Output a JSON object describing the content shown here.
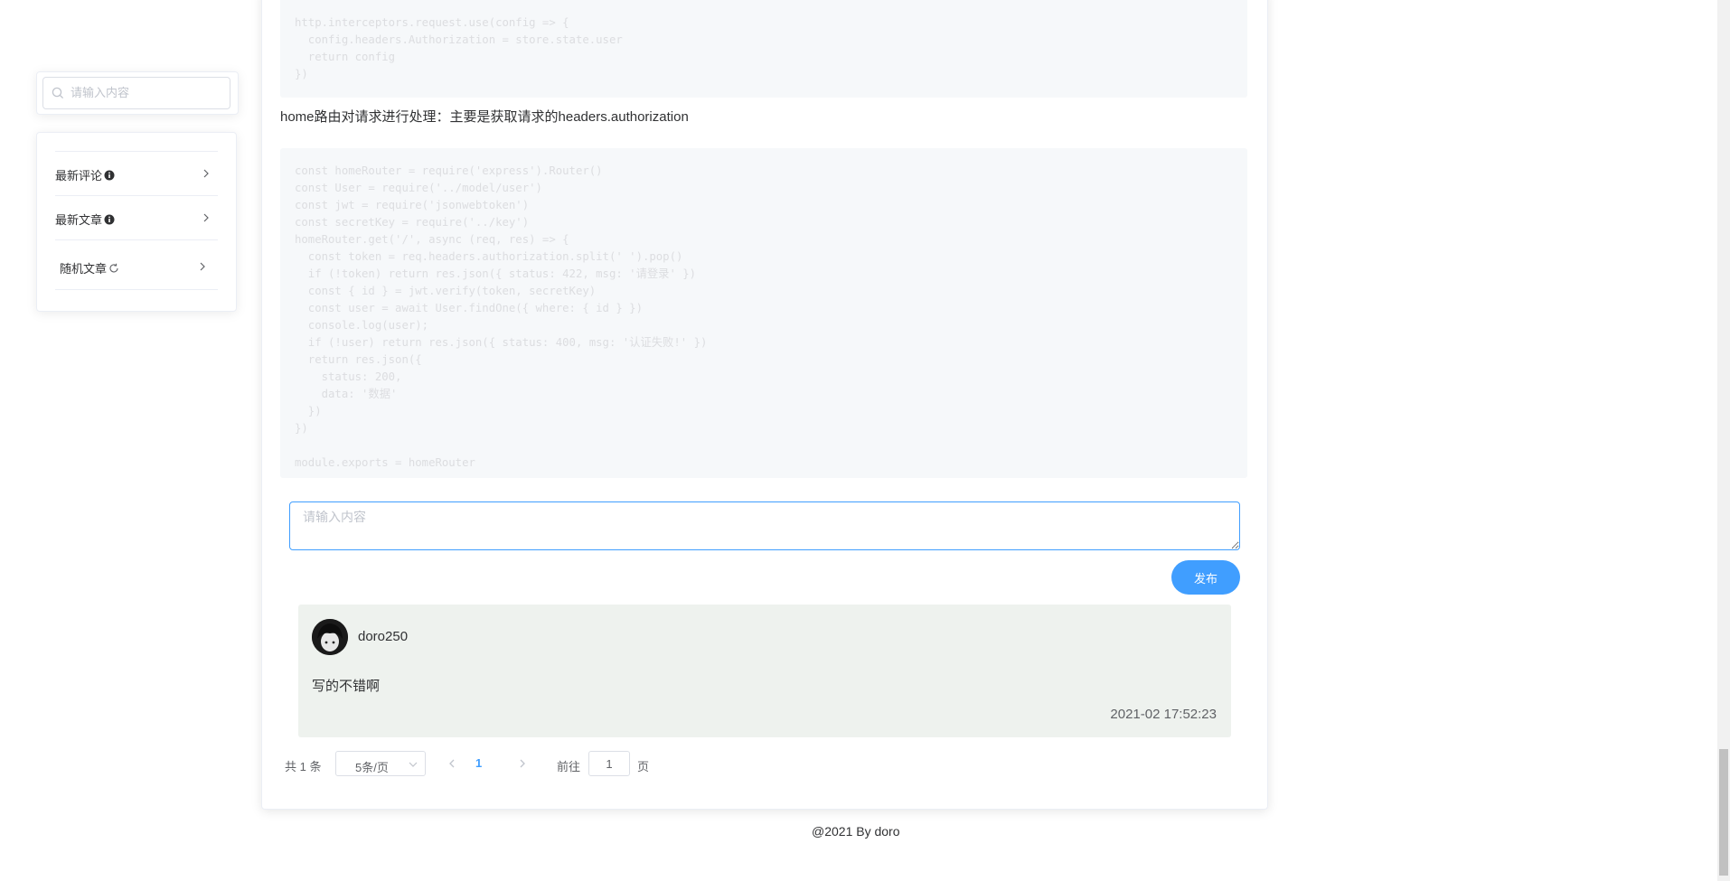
{
  "sidebar": {
    "search_placeholder": "请输入内容",
    "items": [
      {
        "label": "最新评论",
        "icon": "info-circle-icon"
      },
      {
        "label": "最新文章",
        "icon": "info-circle-icon"
      },
      {
        "label": "随机文章",
        "icon": "refresh-icon"
      }
    ]
  },
  "article": {
    "code_block_1": [
      "http.interceptors.request.use(config => {",
      "  config.headers.Authorization = store.state.user",
      "  return config",
      "})"
    ],
    "description": "home路由对请求进行处理：主要是获取请求的headers.authorization",
    "code_block_2": [
      "const homeRouter = require('express').Router()",
      "const User = require('../model/user')",
      "const jwt = require('jsonwebtoken')",
      "const secretKey = require('../key')",
      "homeRouter.get('/', async (req, res) => {",
      "  const token = req.headers.authorization.split(' ').pop()",
      "  if (!token) return res.json({ status: 422, msg: '请登录' })",
      "  const { id } = jwt.verify(token, secretKey)",
      "  const user = await User.findOne({ where: { id } })",
      "  console.log(user);",
      "  if (!user) return res.json({ status: 400, msg: '认证失败!' })",
      "  return res.json({",
      "    status: 200,",
      "    data: '数据'",
      "  })",
      "})",
      "",
      "module.exports = homeRouter"
    ]
  },
  "comment_form": {
    "placeholder": "请输入内容",
    "submit_label": "发布"
  },
  "comments": [
    {
      "username": "doro250",
      "text": "写的不错啊",
      "time": "2021-02 17:52:23"
    }
  ],
  "pagination": {
    "total_text": "共 1 条",
    "page_size": "5条/页",
    "current_page": "1",
    "goto_label": "前往",
    "goto_value": "1",
    "page_suffix": "页"
  },
  "footer": {
    "text": "@2021 By doro"
  },
  "colors": {
    "primary": "#409eff",
    "comment_bg": "#eef2ee",
    "code_bg": "#f6f8fa"
  }
}
